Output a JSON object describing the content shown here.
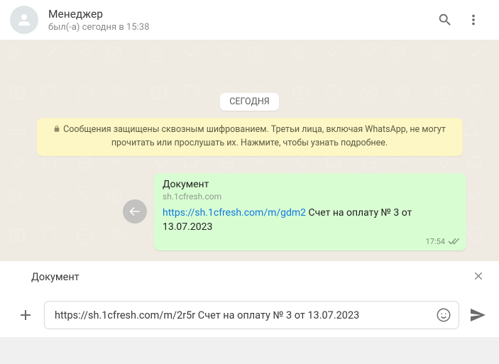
{
  "header": {
    "contact_name": "Менеджер",
    "status": "был(-а) сегодня в 15:38"
  },
  "chat": {
    "date_label": "СЕГОДНЯ",
    "encryption_notice": "Сообщения защищены сквозным шифрованием. Третьи лица, включая WhatsApp, не могут прочитать или прослушать их. Нажмите, чтобы узнать подробнее."
  },
  "message": {
    "title": "Документ",
    "domain": "sh.1cfresh.com",
    "link_text": "https://sh.1cfresh.com/m/gdm2",
    "body_after_link": " Счет на оплату № 3 от 13.07.2023",
    "time": "17:54"
  },
  "reply_preview": {
    "title": "Документ"
  },
  "compose": {
    "value": "https://sh.1cfresh.com/m/2r5r Счет на оплату № 3 от 13.07.2023"
  }
}
